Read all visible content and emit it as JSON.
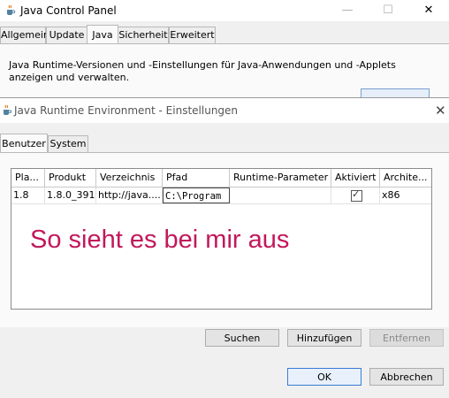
{
  "control_panel": {
    "title": "Java Control Panel",
    "minimize_glyph": "—",
    "maximize_glyph": "☐",
    "close_glyph": "✕",
    "tabs": [
      {
        "label": "Allgemein"
      },
      {
        "label": "Update"
      },
      {
        "label": "Java",
        "active": true
      },
      {
        "label": "Sicherheit"
      },
      {
        "label": "Erweitert"
      }
    ],
    "description": "Java Runtime-Versionen und -Einstellungen für Java-Anwendungen und -Applets anzeigen und verwalten."
  },
  "jre_dialog": {
    "title": "Java Runtime Environment - Einstellungen",
    "close_glyph": "✕",
    "tabs": [
      {
        "label": "Benutzer",
        "active": true
      },
      {
        "label": "System"
      }
    ],
    "table": {
      "columns": [
        "Pla...",
        "Produkt",
        "Verzeichnis",
        "Pfad",
        "Runtime-Parameter",
        "Aktiviert",
        "Archite..."
      ],
      "rows": [
        {
          "platform": "1.8",
          "product": "1.8.0_391",
          "location": "http://java....",
          "path": "C:\\Program ...",
          "runtime_params": "",
          "enabled": true,
          "arch": "x86"
        }
      ]
    },
    "overlay_note": "So sieht es bei mir aus",
    "buttons": {
      "find": "Suchen",
      "add": "Hinzufügen",
      "remove": "Entfernen",
      "ok": "OK",
      "cancel": "Abbrechen"
    }
  },
  "colors": {
    "overlay_text": "#c2185b",
    "primary_border": "#3b7bd4",
    "java_icon_orange": "#e76f00",
    "java_icon_blue": "#5382a1"
  },
  "icons": {
    "window": "java-coffee-cup-icon"
  }
}
